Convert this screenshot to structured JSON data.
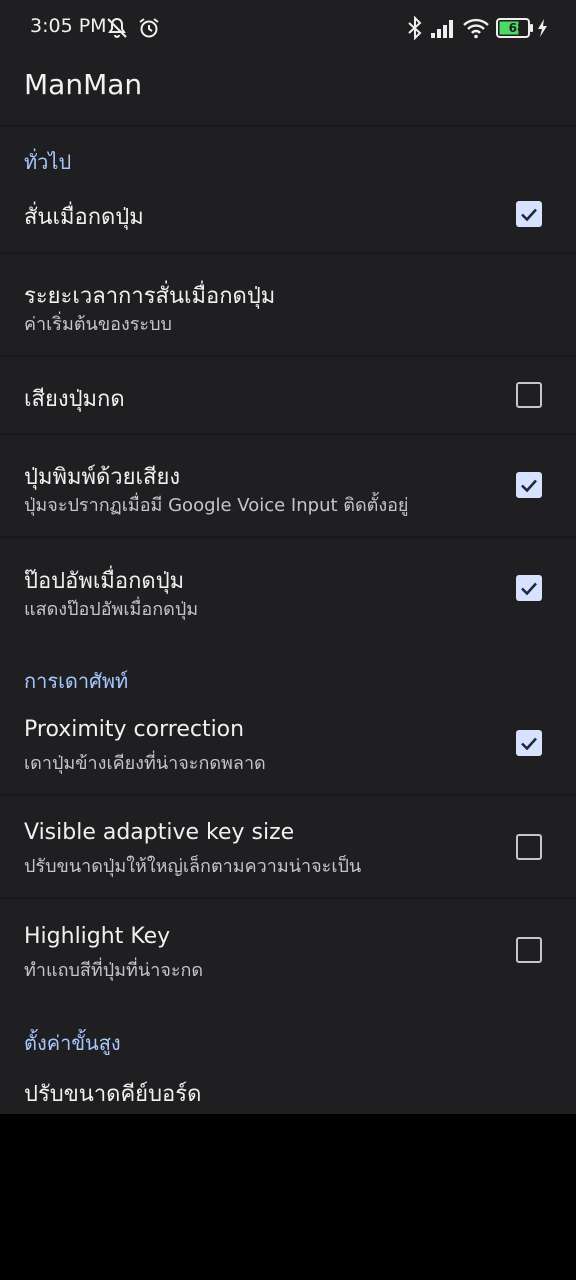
{
  "status_bar": {
    "time": "3:05 PM",
    "battery_level": "68",
    "icons": [
      "notifications-off-icon",
      "alarm-icon",
      "bluetooth-icon",
      "signal-icon",
      "wifi-icon",
      "battery-icon",
      "charging-icon"
    ]
  },
  "app_bar": {
    "title": "ManMan"
  },
  "sections": {
    "general": "ทั่วไป",
    "prediction": "การเดาศัพท์",
    "advanced": "ตั้งค่าขั้นสูง"
  },
  "settings": {
    "vibrate": {
      "title": "สั่นเมื่อกดปุ่ม",
      "checked": true
    },
    "vibrate_duration": {
      "title": "ระยะเวลาการสั่นเมื่อกดปุ่ม",
      "summary": "ค่าเริ่มต้นของระบบ"
    },
    "key_sound": {
      "title": "เสียงปุ่มกด",
      "checked": false
    },
    "voice_key": {
      "title": "ปุ่มพิมพ์ด้วยเสียง",
      "summary": "ปุ่มจะปรากฏเมื่อมี Google Voice Input ติดตั้งอยู่",
      "checked": true
    },
    "popup": {
      "title": "ป๊อปอัพเมื่อกดปุ่ม",
      "summary": "แสดงป๊อปอัพเมื่อกดปุ่ม",
      "checked": true
    },
    "proximity": {
      "title": "Proximity correction",
      "summary": "เดาปุ่มข้างเคียงที่น่าจะกดพลาด",
      "checked": true
    },
    "adaptive_size": {
      "title": "Visible adaptive key size",
      "summary": "ปรับขนาดปุ่มให้ใหญ่เล็กตามความน่าจะเป็น",
      "checked": false
    },
    "highlight": {
      "title": "Highlight Key",
      "summary": "ทำแถบสีที่ปุ่มที่น่าจะกด",
      "checked": false
    },
    "keyboard_size": {
      "title": "ปรับขนาดคีย์บอร์ด"
    }
  },
  "colors": {
    "accent": "#a9c7ff",
    "checkbox_on": "#d6e2ff",
    "background": "#1f1f21"
  }
}
